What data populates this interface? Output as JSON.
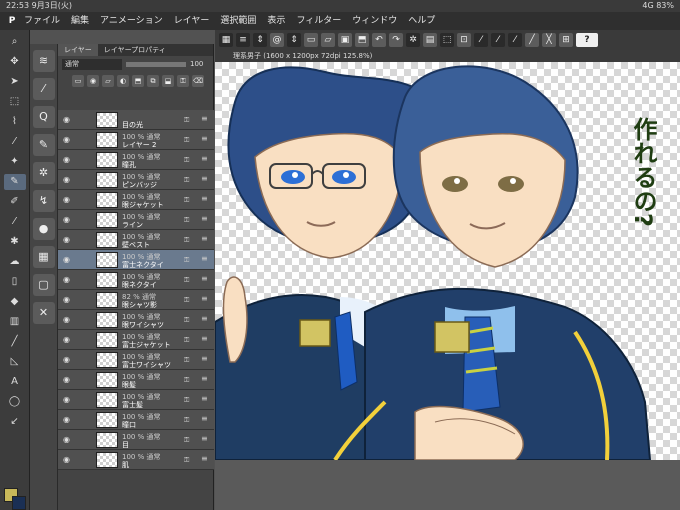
{
  "status": {
    "time_date": "22:53 9月3日(火)",
    "signal": "4G 83%"
  },
  "menu": {
    "logo": "P",
    "items": [
      "ファイル",
      "編集",
      "アニメーション",
      "レイヤー",
      "選択範囲",
      "表示",
      "フィルター",
      "ウィンドウ",
      "ヘルプ"
    ]
  },
  "toolbar": {
    "help": "?"
  },
  "layer_panel": {
    "tabs": [
      "レイヤー",
      "レイヤープロパティ"
    ],
    "blend_mode": "通常",
    "opacity": "100",
    "rows": [
      {
        "top": "",
        "name": "目の光"
      },
      {
        "top": "100 % 通常",
        "name": "レイヤー 2"
      },
      {
        "top": "100 % 通常",
        "name": "瞳孔"
      },
      {
        "top": "100 % 通常",
        "name": "ピンバッジ"
      },
      {
        "top": "100 % 通常",
        "name": "眼ジャケット"
      },
      {
        "top": "100 % 通常",
        "name": "ライン"
      },
      {
        "top": "100 % 通常",
        "name": "壁ベスト"
      },
      {
        "top": "100 % 通常",
        "name": "富士ネクタイ"
      },
      {
        "top": "100 % 通常",
        "name": "眼ネクタイ"
      },
      {
        "top": "82 % 通常",
        "name": "眼シャツ影"
      },
      {
        "top": "100 % 通常",
        "name": "眼ワイシャツ"
      },
      {
        "top": "100 % 通常",
        "name": "富士ジャケット"
      },
      {
        "top": "100 % 通常",
        "name": "富士ワイシャツ"
      },
      {
        "top": "100 % 通常",
        "name": "眼髪"
      },
      {
        "top": "100 % 通常",
        "name": "富士髪"
      },
      {
        "top": "100 % 通常",
        "name": "瞳口"
      },
      {
        "top": "100 % 通常",
        "name": "目"
      },
      {
        "top": "100 % 通常",
        "name": "肌"
      }
    ],
    "selected_index": 7
  },
  "canvas": {
    "tab_title": "理系男子 (1600 x 1200px 72dpi 125.8%)",
    "handwriting": "作れるの?"
  },
  "colors": {
    "main": "#c8b85a",
    "sub": "#1a2f54"
  }
}
